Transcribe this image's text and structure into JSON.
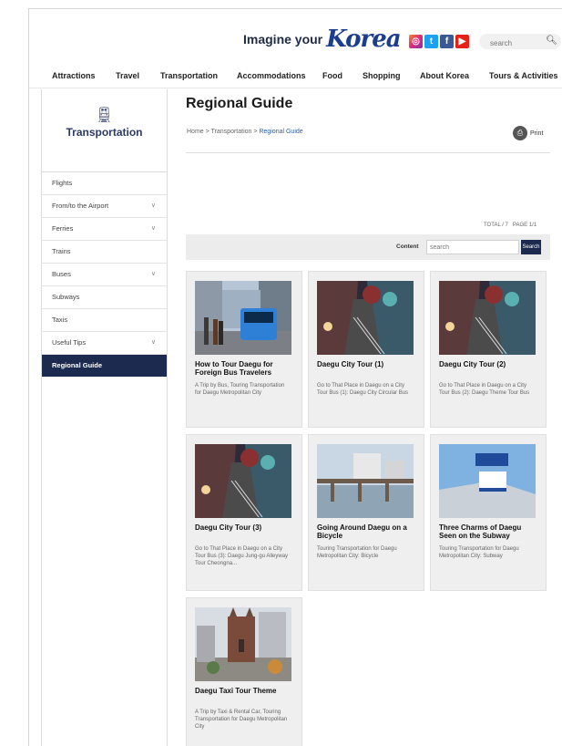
{
  "header": {
    "tagline": "Imagine your",
    "brand": "Korea",
    "search_placeholder": "search",
    "social": [
      "instagram-icon",
      "twitter-icon",
      "facebook-icon",
      "youtube-icon"
    ]
  },
  "nav": [
    "Attractions",
    "Travel",
    "Transportation",
    "Accommodations",
    "Food",
    "Shopping",
    "About Korea",
    "Tours & Activities"
  ],
  "sidebar": {
    "title": "Transportation",
    "items": [
      {
        "label": "Flights",
        "expand": false
      },
      {
        "label": "From/to the Airport",
        "expand": true
      },
      {
        "label": "Ferries",
        "expand": true
      },
      {
        "label": "Trains",
        "expand": false
      },
      {
        "label": "Buses",
        "expand": true
      },
      {
        "label": "Subways",
        "expand": false
      },
      {
        "label": "Taxis",
        "expand": false
      },
      {
        "label": "Useful Tips",
        "expand": true
      },
      {
        "label": "Regional Guide",
        "expand": false
      }
    ]
  },
  "page": {
    "title": "Regional Guide",
    "breadcrumb_home": "Home",
    "breadcrumb_sep": " > ",
    "breadcrumb_mid": "Transportation",
    "breadcrumb_current": "Regional Guide",
    "print_label": "Print",
    "total": "TOTAL / 7",
    "page_info": "PAGE 1/1"
  },
  "filter": {
    "label": "Content",
    "placeholder": "search",
    "button": "Search"
  },
  "cards": [
    {
      "title": "How to Tour Daegu for Foreign Bus Travelers",
      "desc": "A Trip by Bus, Touring Transportation for Daegu Metropolitan City"
    },
    {
      "title": "Daegu City Tour (1)",
      "desc": "Go to That Place in Daegu on a City Tour Bus (1): Daegu City Circular Bus"
    },
    {
      "title": "Daegu City Tour (2)",
      "desc": "Go to That Place in Daegu on a City Tour Bus (2): Daegu Theme Tour Bus"
    },
    {
      "title": "Daegu City Tour (3)",
      "desc": "Go to That Place in Daegu on a City Tour Bus (3): Daegu Jung-gu Alleyway Tour Cheongna..."
    },
    {
      "title": "Going Around Daegu on a Bicycle",
      "desc": "Touring Transportation for Daegu Metropolitan City: Bicycle"
    },
    {
      "title": "Three Charms of Daegu Seen on the Subway",
      "desc": "Touring Transportation for Daegu Metropolitan City: Subway"
    },
    {
      "title": "Daegu Taxi Tour Theme",
      "desc": "A Trip by Taxi & Rental Car, Touring Transportation for Daegu Metropolitan City"
    }
  ]
}
